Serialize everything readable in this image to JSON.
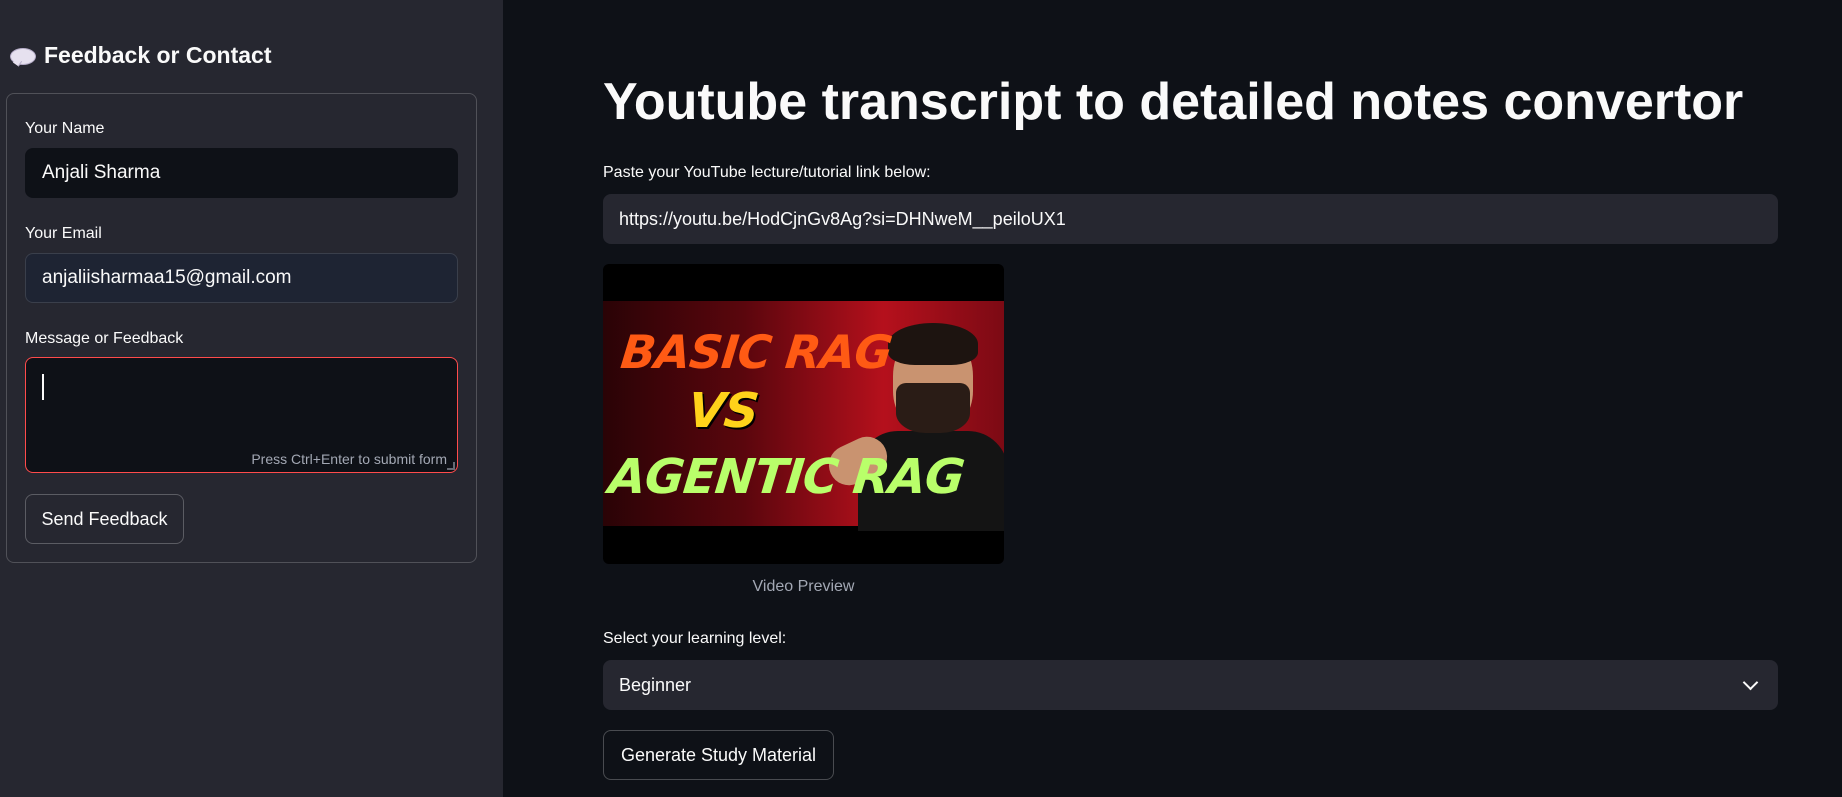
{
  "sidebar": {
    "header": {
      "icon": "speech-bubble-icon",
      "title": "Feedback or Contact"
    },
    "form": {
      "name_label": "Your Name",
      "name_value": "Anjali Sharma",
      "email_label": "Your Email",
      "email_value": "anjaliisharmaa15@gmail.com",
      "message_label": "Message or Feedback",
      "message_value": "",
      "message_hint": "Press Ctrl+Enter to submit form",
      "submit_label": "Send Feedback"
    }
  },
  "main": {
    "title": "Youtube transcript to detailed notes convertor",
    "url_label": "Paste your YouTube lecture/tutorial link below:",
    "url_value": "https://youtu.be/HodCjnGv8Ag?si=DHNweM__peiloUX1",
    "thumbnail": {
      "line1": "BASIC RAG",
      "line2": "VS",
      "line3": "AGENTIC RAG"
    },
    "preview_caption": "Video Preview",
    "level_label": "Select your learning level:",
    "level_value": "Beginner",
    "generate_label": "Generate Study Material"
  },
  "colors": {
    "background": "#0e1117",
    "sidebar": "#262730",
    "input": "#262730",
    "focus_border": "#ff4b4b",
    "text": "#fafafa",
    "muted": "#a3a8b4"
  }
}
